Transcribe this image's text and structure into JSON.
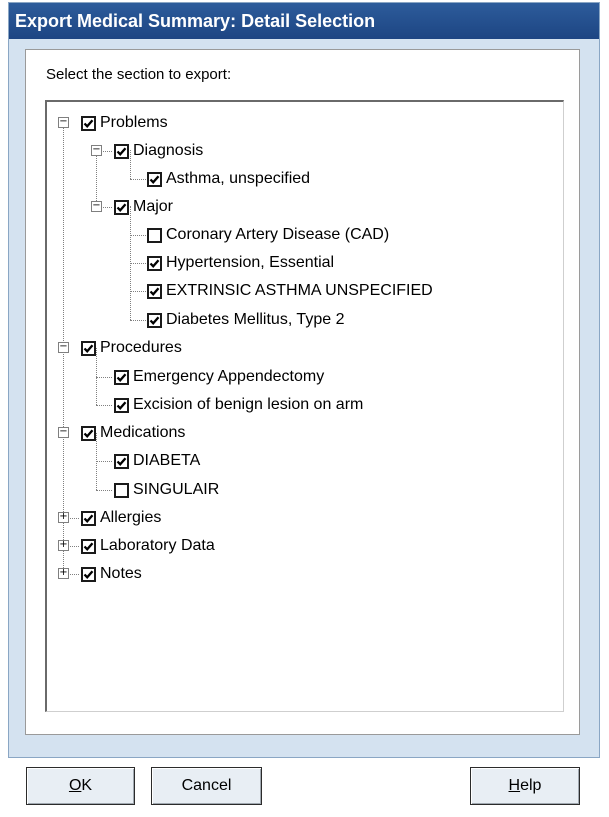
{
  "window": {
    "title": "Export Medical Summary: Detail Selection"
  },
  "prompt": "Select the section to export:",
  "tree": [
    {
      "key": "problems",
      "label": "Problems",
      "checked": true,
      "expander": "minus"
    },
    {
      "key": "diagnosis",
      "label": "Diagnosis",
      "checked": true,
      "expander": "minus"
    },
    {
      "key": "asthma-unspecified",
      "label": "Asthma, unspecified",
      "checked": true
    },
    {
      "key": "major",
      "label": "Major",
      "checked": true,
      "expander": "minus"
    },
    {
      "key": "cad",
      "label": "Coronary Artery Disease (CAD)",
      "checked": false
    },
    {
      "key": "hypertension",
      "label": "Hypertension, Essential",
      "checked": true
    },
    {
      "key": "extrinsic-asthma",
      "label": "EXTRINSIC ASTHMA UNSPECIFIED",
      "checked": true
    },
    {
      "key": "diabetes",
      "label": "Diabetes Mellitus, Type 2",
      "checked": true
    },
    {
      "key": "procedures",
      "label": "Procedures",
      "checked": true,
      "expander": "minus"
    },
    {
      "key": "appendectomy",
      "label": "Emergency Appendectomy",
      "checked": true
    },
    {
      "key": "excision",
      "label": "Excision of benign lesion on arm",
      "checked": true
    },
    {
      "key": "medications",
      "label": "Medications",
      "checked": true,
      "expander": "minus"
    },
    {
      "key": "diabeta",
      "label": "DIABETA",
      "checked": true
    },
    {
      "key": "singulair",
      "label": "SINGULAIR",
      "checked": false
    },
    {
      "key": "allergies",
      "label": "Allergies",
      "checked": true,
      "expander": "plus"
    },
    {
      "key": "laboratory-data",
      "label": "Laboratory Data",
      "checked": true,
      "expander": "plus"
    },
    {
      "key": "notes",
      "label": "Notes",
      "checked": true,
      "expander": "plus"
    }
  ],
  "buttons": {
    "ok": {
      "mnemonic": "O",
      "rest": "K"
    },
    "cancel": "Cancel",
    "help": {
      "mnemonic": "H",
      "rest": "elp"
    }
  },
  "colors": {
    "titlebar": "#1d4583",
    "dialog_background": "#d4e2f0",
    "check_mark": "#000000"
  },
  "icons": {
    "expander_open": "minus-box-icon",
    "expander_closed": "plus-box-icon",
    "checkbox": "checkbox-icon"
  }
}
